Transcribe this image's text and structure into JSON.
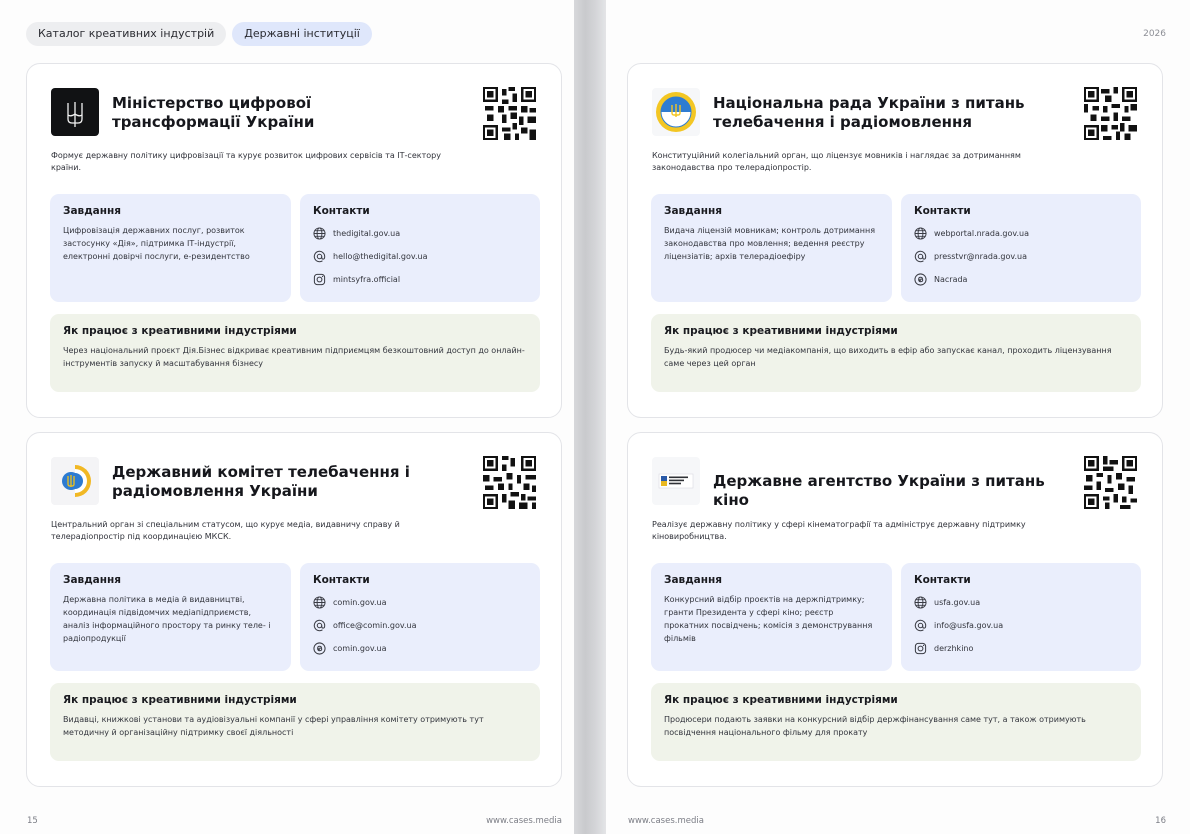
{
  "header": {
    "pill_catalog": "Каталог креативних індустрій",
    "pill_state": "Державні інституції",
    "year": "2026"
  },
  "labels": {
    "tasks": "Завдання",
    "contacts": "Контакти",
    "creative": "Як працює з креативними індустріями"
  },
  "cards": [
    {
      "title": "Міністерство цифрової трансформації України",
      "description": "Формує державну політику цифровізації та курує розвиток цифрових сервісів та ІТ-сектору країни.",
      "tasks": "Цифровізація державних послуг, розвиток застосунку «Дія», підтримка ІТ-індустрії, електронні довірчі послуги, е-резидентство",
      "contacts": [
        {
          "icon": "web-icon",
          "text": "thedigital.gov.ua"
        },
        {
          "icon": "email-icon",
          "text": "hello@thedigital.gov.ua"
        },
        {
          "icon": "instagram-icon",
          "text": "mintsyfra.official"
        }
      ],
      "creative": "Через національний проєкт Дія.Бізнес відкриває креативним підприємцям безкоштовний доступ до онлайн-інструментів запуску й масштабування бізнесу"
    },
    {
      "title": "Державний комітет телебачення і радіомовлення України",
      "description": "Центральний орган зі спеціальним статусом, що курує медіа, видавничу справу й телерадіопростір під координацією МКСК.",
      "tasks": "Державна політика в медіа й видавництві, координація підвідомчих медіапідприємств, аналіз інформаційного простору та ринку теле- і радіопродукції",
      "contacts": [
        {
          "icon": "web-icon",
          "text": "comin.gov.ua"
        },
        {
          "icon": "email-icon",
          "text": "office@comin.gov.ua"
        },
        {
          "icon": "threads-icon",
          "text": "comin.gov.ua"
        }
      ],
      "creative": "Видавці, книжкові установи та аудіовізуальні компанії у сфері управління комітету отримують тут методичну й організаційну підтримку своєї діяльності"
    },
    {
      "title": "Національна рада України з питань телебачення і радіомовлення",
      "description": "Конституційний колегіальний орган, що ліцензує мовників і наглядає за дотриманням законодавства про телерадіопростір.",
      "tasks": "Видача ліцензій мовникам; контроль дотримання законодавства про мовлення; ведення реєстру ліцензіатів; архів телерадіоефіру",
      "contacts": [
        {
          "icon": "web-icon",
          "text": "webportal.nrada.gov.ua"
        },
        {
          "icon": "email-icon",
          "text": "presstvr@nrada.gov.ua"
        },
        {
          "icon": "threads-icon",
          "text": "Nacrada"
        }
      ],
      "creative": "Будь-який продюсер чи медіакомпанія, що виходить в ефір або запускає канал, проходить ліцензування саме через цей орган"
    },
    {
      "title": "Державне агентство України з питань кіно",
      "description": "Реалізує державну політику у сфері кінематографії та адмініструє державну підтримку кіновиробництва.",
      "tasks": "Конкурсний відбір проєктів на держпідтримку; гранти Президента у сфері кіно; реєстр прокатних посвідчень; комісія з демонстрування фільмів",
      "contacts": [
        {
          "icon": "web-icon",
          "text": "usfa.gov.ua"
        },
        {
          "icon": "email-icon",
          "text": "info@usfa.gov.ua"
        },
        {
          "icon": "instagram-icon",
          "text": "derzhkino"
        }
      ],
      "creative": "Продюсери подають заявки на конкурсний відбір держфінансування саме тут, а також отримують посвідчення національного фільму для прокату"
    }
  ],
  "footer": {
    "page_left": "15",
    "site_left": "www.cases.media",
    "site_right": "www.cases.media",
    "page_right": "16"
  }
}
